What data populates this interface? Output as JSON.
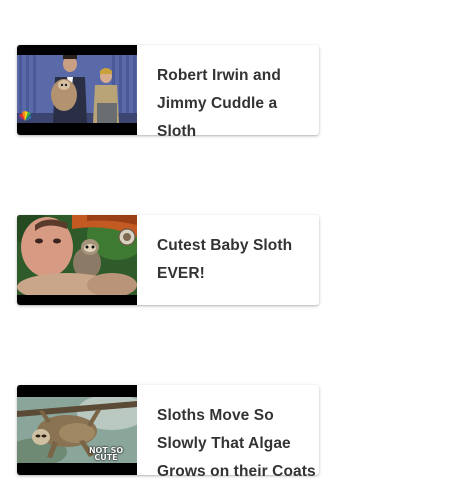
{
  "videos": [
    {
      "title": "Robert Irwin and\nJimmy Cuddle a Sloth",
      "thumbnail_icon": "talk-show-sloth-thumbnail"
    },
    {
      "title": "Cutest Baby Sloth\nEVER!",
      "thumbnail_icon": "baby-sloth-thumbnail"
    },
    {
      "title": "Sloths Move So\nSlowly That Algae\nGrows on their Coats",
      "thumbnail_icon": "sloth-on-branch-thumbnail",
      "thumbnail_overlay": "NOT SO CUTE"
    }
  ],
  "colors": {
    "title_text": "#333333",
    "card_background": "#ffffff",
    "thumbnail_letterbox": "#000000"
  }
}
